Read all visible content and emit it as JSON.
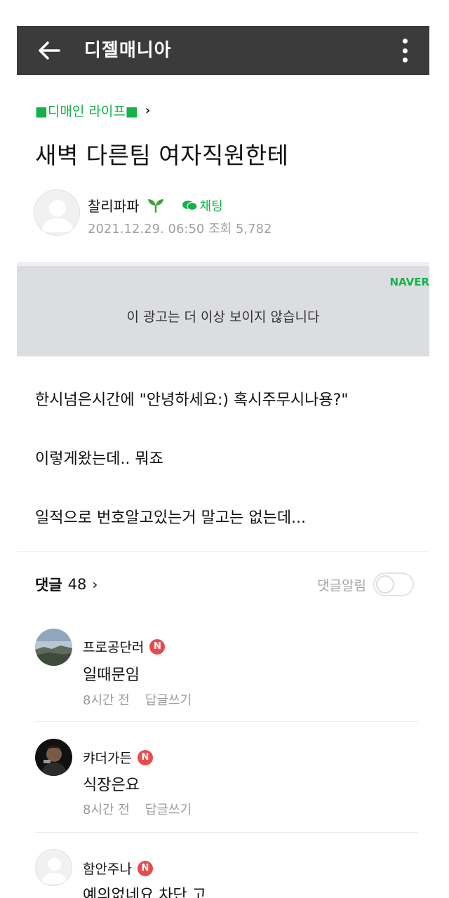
{
  "header": {
    "back_icon": "arrow-left-icon",
    "title": "디젤매니아",
    "more_icon": "more-vertical-icon"
  },
  "category": {
    "label": "■디매인 라이프■",
    "chevron": "›"
  },
  "post": {
    "title": "새벽 다른팀 여자직원한테",
    "author": "찰리파파",
    "author_badge_icon": "sprout-icon",
    "chat_label": "채팅",
    "datetime": "2021.12.29. 06:50",
    "views_label": "조회 5,782",
    "body": [
      "한시넘은시간에 \"안녕하세요:) 혹시주무시나용?\"",
      "이렇게왔는데.. 뭐죠",
      "일적으로 번호알고있는거 말고는 없는데..."
    ]
  },
  "ad": {
    "brand": "NAVER",
    "text": "이 광고는 더 이상 보이지 않습니다"
  },
  "comments": {
    "title": "댓글",
    "count": "48",
    "chevron": "›",
    "alert_label": "댓글알림",
    "alert_on": false,
    "items": [
      {
        "author": "프로공단러",
        "badge": "N",
        "text": "일때문임",
        "time": "8시간 전",
        "reply": "답글쓰기",
        "avatar": "landscape-photo"
      },
      {
        "author": "캬더가든",
        "badge": "N",
        "text": "식장은요",
        "time": "8시간 전",
        "reply": "답글쓰기",
        "avatar": "person-photo"
      },
      {
        "author": "함안주나",
        "badge": "N",
        "text": "예의없네요 차단 고",
        "avatar": "default-avatar"
      }
    ]
  },
  "colors": {
    "header_bg": "#3b3b3b",
    "accent_green": "#14b24a",
    "badge_red": "#e74c4c",
    "ad_bg": "#dcdde1"
  }
}
